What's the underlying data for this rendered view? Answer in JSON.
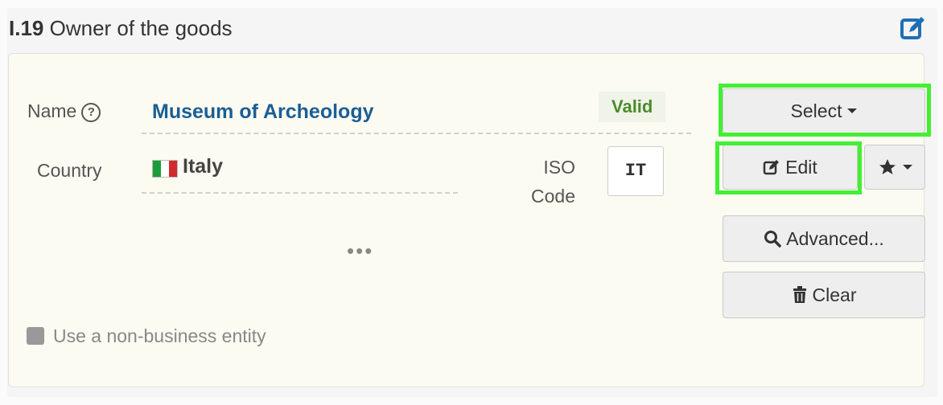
{
  "section": {
    "number": "I.19",
    "title": "Owner of the goods",
    "edit_icon": "edit-square-icon"
  },
  "form": {
    "name_label": "Name",
    "name_value": "Museum of Archeology",
    "status": "Valid",
    "country_label": "Country",
    "country_value": "Italy",
    "country_flag_colors": [
      "#1a9e3a",
      "#ffffff",
      "#d32b2b"
    ],
    "iso_label_line1": "ISO",
    "iso_label_line2": "Code",
    "iso_value": "IT",
    "more": "•••",
    "non_business_label": "Use a non-business entity"
  },
  "actions": {
    "select": "Select",
    "edit": "Edit",
    "advanced": "Advanced...",
    "clear": "Clear",
    "favorite_icon": "star-icon"
  },
  "colors": {
    "highlight": "#44ee33",
    "link_blue": "#1a5e96",
    "valid_green": "#4b8a2c"
  }
}
